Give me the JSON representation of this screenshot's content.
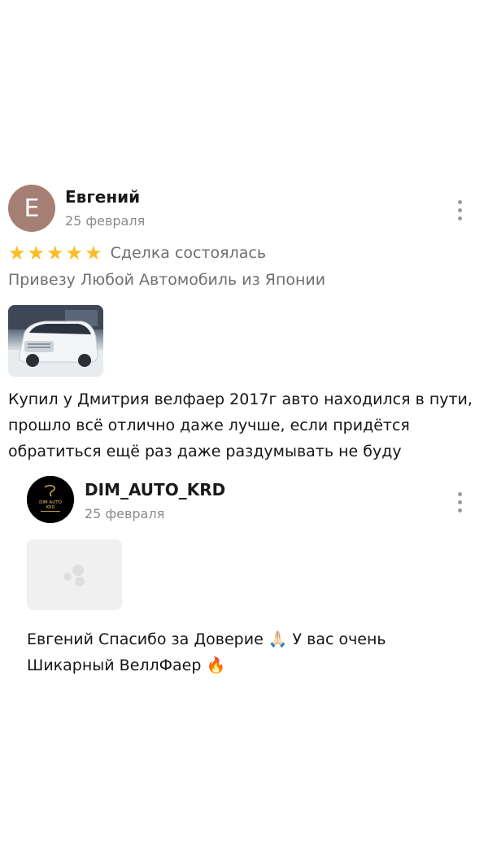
{
  "review": {
    "avatar_letter": "Е",
    "author": "Евгений",
    "date": "25 февраля",
    "rating": 5,
    "star_char": "★",
    "deal_status": "Сделка состоялась",
    "category": "Привезу Любой Автомобиль из Японии",
    "text": "Купил у Дмитрия велфаер 2017г авто находился в пути, прошло всё отлично даже лучше, если придётся обратиться ещё раз даже раздумывать не буду"
  },
  "reply": {
    "author": "DIM_AUTO_KRD",
    "date": "25 февраля",
    "avatar_text_line1": "DIM AUTO",
    "avatar_text_line2": "KRD",
    "text": "Евгений Спасибо за Доверие 🙏🏻 У вас очень Шикарный ВеллФаер 🔥"
  },
  "colors": {
    "star": "#fbbd25",
    "avatar_bg": "#a67f74",
    "meta_text": "#8a8a8a"
  }
}
